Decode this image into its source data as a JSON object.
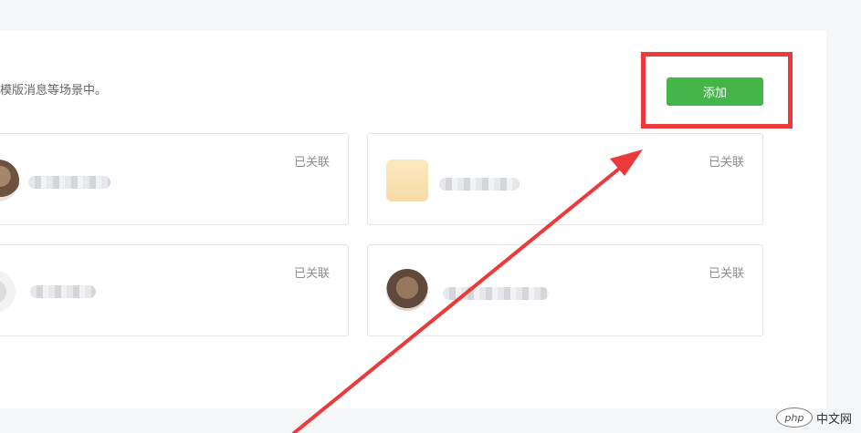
{
  "header": {
    "description": "模版消息等场景中。"
  },
  "toolbar": {
    "add_label": "添加"
  },
  "accounts": [
    {
      "status": "已关联"
    },
    {
      "status": "已关联"
    },
    {
      "status": "已关联"
    },
    {
      "status": "已关联"
    }
  ],
  "watermark": {
    "logo_text": "php",
    "site_text": "中文网"
  },
  "colors": {
    "accent": "#44b549",
    "highlight": "#ec3a3a"
  }
}
